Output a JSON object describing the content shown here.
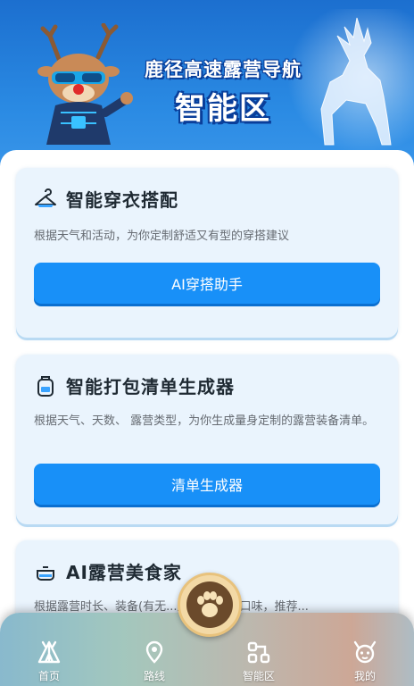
{
  "header": {
    "title_line1": "鹿径高速露营导航",
    "title_line2": "智能区"
  },
  "cards": [
    {
      "title": "智能穿衣搭配",
      "icon": "hanger-icon",
      "description": "根据天气和活动，为你定制舒适又有型的穿搭建议",
      "button_label": "AI穿搭助手"
    },
    {
      "title": "智能打包清单生成器",
      "icon": "backpack-icon",
      "description": "根据天气、天数、 露营类型，为你生成量身定制的露营装备清单。",
      "button_label": "清单生成器"
    },
    {
      "title": "AI露营美食家",
      "icon": "cooking-pot-icon",
      "description": "根据露营时长、装备(有无...炉)、人数和口味，推荐..."
    }
  ],
  "nav": {
    "items": [
      {
        "label": "首页",
        "icon": "tent-icon"
      },
      {
        "label": "路线",
        "icon": "map-pin-icon"
      },
      {
        "label": "智能区",
        "icon": "smart-nodes-icon"
      },
      {
        "label": "我的",
        "icon": "deer-face-icon"
      }
    ],
    "center_button_icon": "paw-icon"
  },
  "colors": {
    "hero_blue": "#1e7fd8",
    "button_blue": "#1890f8",
    "card_bg": "#eaf4fd"
  }
}
